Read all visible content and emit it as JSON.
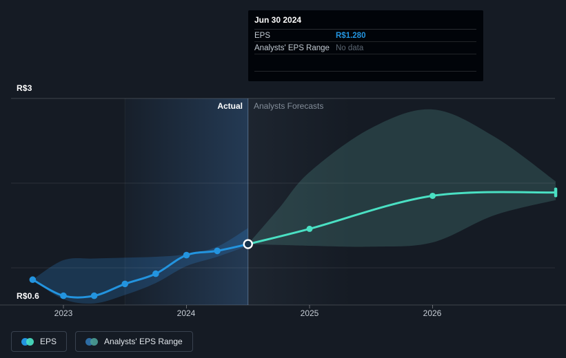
{
  "tooltip": {
    "title": "Jun 30 2024",
    "rows": [
      {
        "label": "EPS",
        "value": "R$1.280"
      },
      {
        "label": "Analysts' EPS Range",
        "value": "No data"
      }
    ]
  },
  "axis": {
    "y_top_label": "R$3",
    "y_bottom_label": "R$0.6",
    "x_ticks": [
      "2023",
      "2024",
      "2025",
      "2026"
    ]
  },
  "sections": {
    "actual_label": "Actual",
    "forecast_label": "Analysts Forecasts"
  },
  "legend": [
    {
      "label": "EPS",
      "colors": [
        "#2394df",
        "#4ae0c3"
      ]
    },
    {
      "label": "Analysts' EPS Range",
      "colors": [
        "#2d6ca3",
        "#4a9b94"
      ]
    }
  ],
  "colors": {
    "background": "#151b24",
    "accent_blue": "#2394df",
    "accent_teal": "#4ae0c3",
    "actual_band_fill": "rgba(45,130,210,0.26)",
    "forecast_band_fill": "rgba(105,185,175,0.21)",
    "highlight_band": "rgba(70,130,195,0.30)",
    "divider_line": "rgba(150,185,220,0.45)",
    "gridline_strong": "rgba(255,255,255,0.18)",
    "gridline_soft": "rgba(255,255,255,0.09)",
    "hover_marker_fill": "#17344e",
    "hover_marker_ring": "#ffffff",
    "tooltip_bg": "#010409",
    "muted_text": "#848e9a"
  },
  "chart_data": {
    "type": "line",
    "title": "EPS — Actual vs Analysts Forecasts",
    "currency": "R$",
    "x_unit": "year",
    "ylim": [
      0.56,
      3.0
    ],
    "y_gridline_values": [
      3,
      2,
      1
    ],
    "x_ticks": [
      2023,
      2024,
      2025,
      2026
    ],
    "divider_x": 2024.5,
    "series": [
      {
        "name": "EPS (Actual)",
        "x": [
          2022.75,
          2023.0,
          2023.25,
          2023.5,
          2023.75,
          2024.0,
          2024.25,
          2024.5
        ],
        "values": [
          0.86,
          0.67,
          0.67,
          0.81,
          0.93,
          1.15,
          1.2,
          1.28
        ]
      },
      {
        "name": "EPS (Analysts Forecast)",
        "x": [
          2024.5,
          2025.0,
          2026.0,
          2027.0
        ],
        "values": [
          1.28,
          1.46,
          1.85,
          1.89
        ]
      }
    ],
    "actual_band": {
      "x": [
        2022.75,
        2023.0,
        2023.25,
        2023.5,
        2023.75,
        2024.0,
        2024.25,
        2024.5
      ],
      "low": [
        0.86,
        0.63,
        0.58,
        0.68,
        0.82,
        1.02,
        1.13,
        1.26
      ],
      "high": [
        0.86,
        1.09,
        1.11,
        1.12,
        1.13,
        1.16,
        1.25,
        1.47
      ]
    },
    "forecast_band": {
      "x": [
        2024.5,
        2024.75,
        2025.0,
        2025.5,
        2026.0,
        2026.5,
        2027.0
      ],
      "low": [
        1.28,
        1.27,
        1.26,
        1.25,
        1.3,
        1.62,
        1.8
      ],
      "high": [
        1.28,
        1.7,
        2.13,
        2.65,
        2.87,
        2.55,
        2.02
      ]
    },
    "highlight_point": {
      "x": 2024.5,
      "value": 1.28,
      "date": "Jun 30 2024"
    },
    "legend_position": "bottom-left",
    "grid": "horizontal-only"
  }
}
